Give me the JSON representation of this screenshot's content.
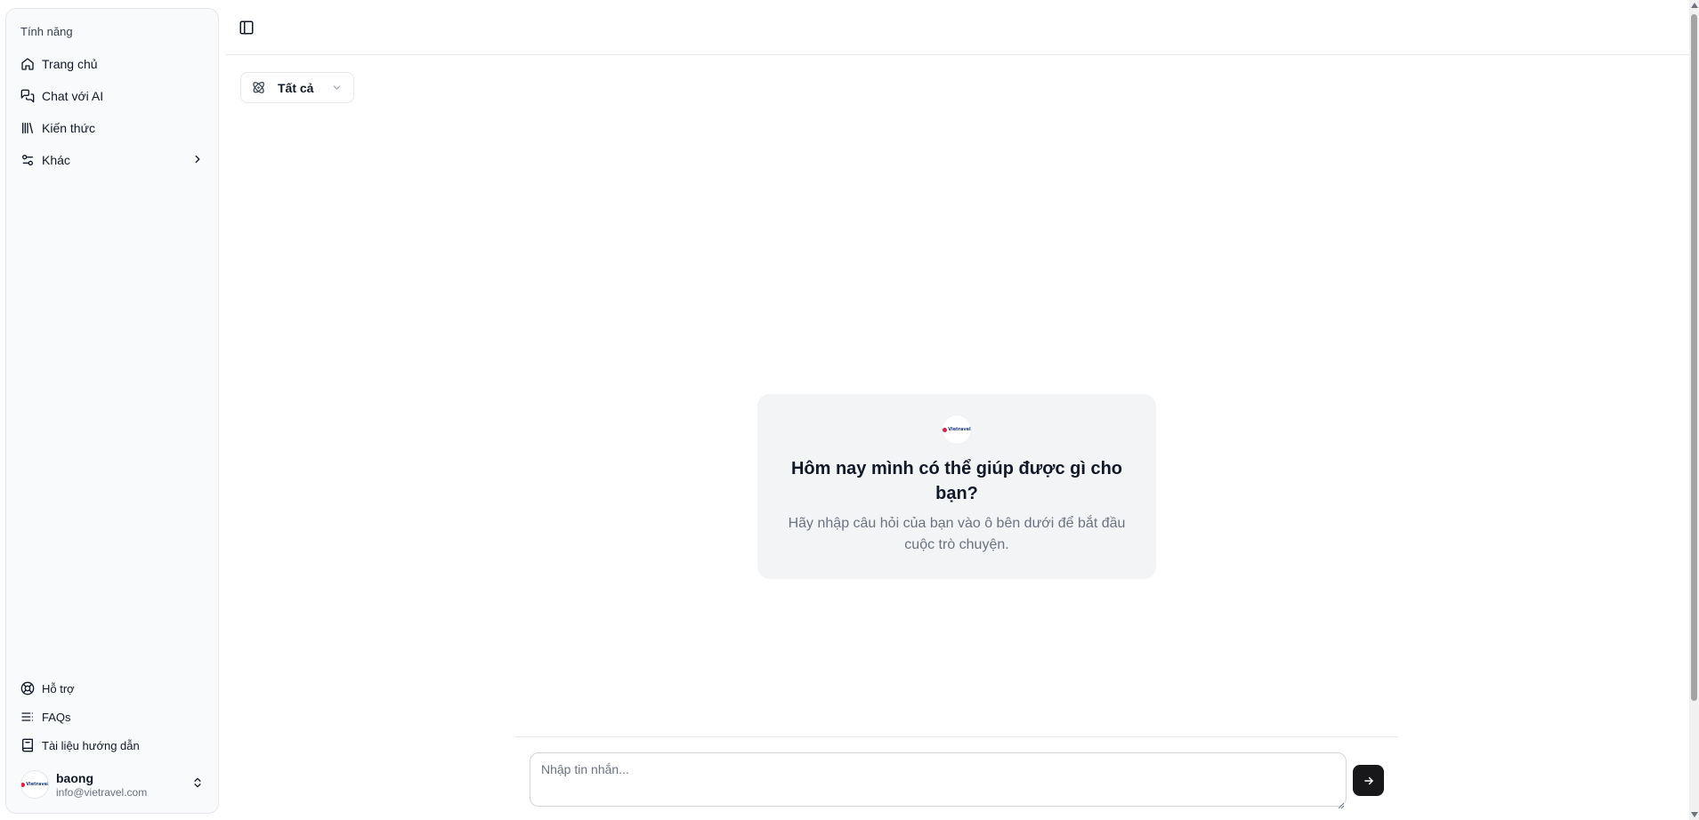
{
  "sidebar": {
    "group_label": "Tính năng",
    "items": [
      {
        "label": "Trang chủ",
        "icon": "home-icon"
      },
      {
        "label": "Chat với AI",
        "icon": "messages-icon"
      },
      {
        "label": "Kiến thức",
        "icon": "library-icon"
      },
      {
        "label": "Khác",
        "icon": "settings-sliders-icon",
        "has_submenu": true
      }
    ],
    "bottom_items": [
      {
        "label": "Hỗ trợ",
        "icon": "lifebuoy-icon"
      },
      {
        "label": "FAQs",
        "icon": "list-icon"
      },
      {
        "label": "Tài liệu hướng dẫn",
        "icon": "book-icon"
      }
    ],
    "user": {
      "name": "baong",
      "email": "info@vietravel.com",
      "logo_text": "Vietravel"
    }
  },
  "header": {
    "toggle_icon": "sidebar-toggle-icon"
  },
  "filter": {
    "label": "Tất cả",
    "icon": "atom-icon"
  },
  "welcome": {
    "title": "Hôm nay mình có thể giúp được gì cho bạn?",
    "subtitle": "Hãy nhập câu hỏi của bạn vào ô bên dưới để bắt đầu cuộc trò chuyện."
  },
  "composer": {
    "placeholder": "Nhập tin nhắn...",
    "value": ""
  },
  "colors": {
    "accent": "#18181b",
    "sidebar_bg": "#f9fafb",
    "card_bg": "#f3f4f6",
    "brand_red": "#e11d48",
    "brand_blue": "#1e3a8a"
  }
}
